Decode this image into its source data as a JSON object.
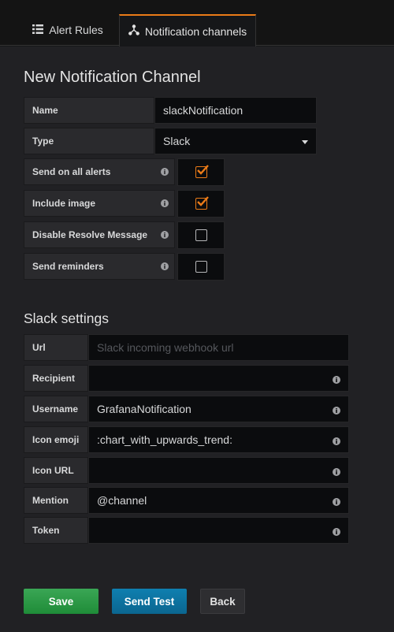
{
  "tabs": [
    {
      "label": "Alert Rules",
      "icon": "list-icon",
      "active": false
    },
    {
      "label": "Notification channels",
      "icon": "share-nodes-icon",
      "active": true
    }
  ],
  "page_title": "New Notification Channel",
  "general": {
    "name_label": "Name",
    "name_value": "slackNotification",
    "type_label": "Type",
    "type_value": "Slack",
    "options": [
      {
        "label": "Send on all alerts",
        "checked": true
      },
      {
        "label": "Include image",
        "checked": true
      },
      {
        "label": "Disable Resolve Message",
        "checked": false
      },
      {
        "label": "Send reminders",
        "checked": false
      }
    ]
  },
  "slack_title": "Slack settings",
  "slack": {
    "url": {
      "label": "Url",
      "value": "",
      "placeholder": "Slack incoming webhook url"
    },
    "recipient": {
      "label": "Recipient",
      "value": ""
    },
    "username": {
      "label": "Username",
      "value": "GrafanaNotification"
    },
    "icon_emoji": {
      "label": "Icon emoji",
      "value": ":chart_with_upwards_trend:"
    },
    "icon_url": {
      "label": "Icon URL",
      "value": ""
    },
    "mention": {
      "label": "Mention",
      "value": "@channel"
    },
    "token": {
      "label": "Token",
      "value": ""
    }
  },
  "buttons": {
    "save": "Save",
    "send_test": "Send Test",
    "back": "Back"
  },
  "colors": {
    "accent": "#eb7b18",
    "save": "#299c46",
    "send_test": "#0d76a6"
  }
}
